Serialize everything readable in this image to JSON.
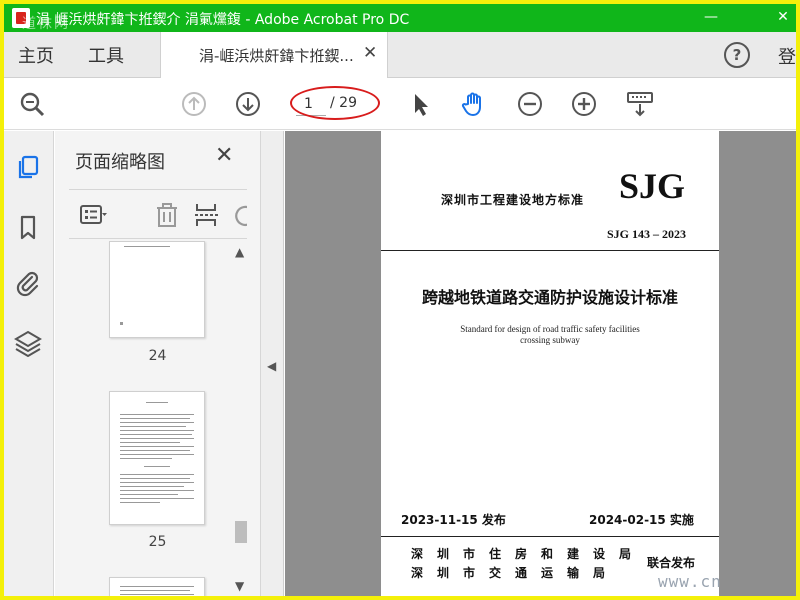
{
  "window": {
    "title": "涓   崕浜烘皯鍏卞拰鍥介   涓氭爣鍑 - Adobe Acrobat Pro DC",
    "watermark": "道袜网",
    "minimize": "—",
    "maximize": "☐",
    "close": "✕"
  },
  "menu": {
    "home": "主页",
    "tools": "工具",
    "doc_tab": "涓‑崕浜烘皯鍏卞拰鍥...",
    "doc_tab_close": "✕",
    "help": "?",
    "login": "登"
  },
  "toolbar": {
    "page_current": "1",
    "page_total": "/ 29"
  },
  "thumbnails": {
    "title": "页面缩略图",
    "close": "✕",
    "pages": [
      {
        "number": "24"
      },
      {
        "number": "25"
      }
    ],
    "scroll_up": "▲",
    "scroll_down": "▼"
  },
  "collapse_arrow": "◀",
  "document": {
    "standard_title": "深圳市工程建设地方标准",
    "brand": "SJG",
    "code": "SJG 143 – 2023",
    "cn_title": "跨越地铁道路交通防护设施设计标准",
    "en_title_line1": "Standard for design of road traffic safety facilities",
    "en_title_line2": "crossing subway",
    "issue_date": "2023-11-15  发布",
    "impl_date": "2024-02-15  实施",
    "org_line1": "深圳市住房和建设局",
    "org_line2": "深圳市交通运输局",
    "joint_issue": "联合发布"
  },
  "site_watermark": "www.cn",
  "colors": {
    "titlebar": "#10b61a",
    "accent_blue": "#1a73e8",
    "highlight_red": "#d81c1c",
    "border_yellow": "#f4f00a"
  }
}
